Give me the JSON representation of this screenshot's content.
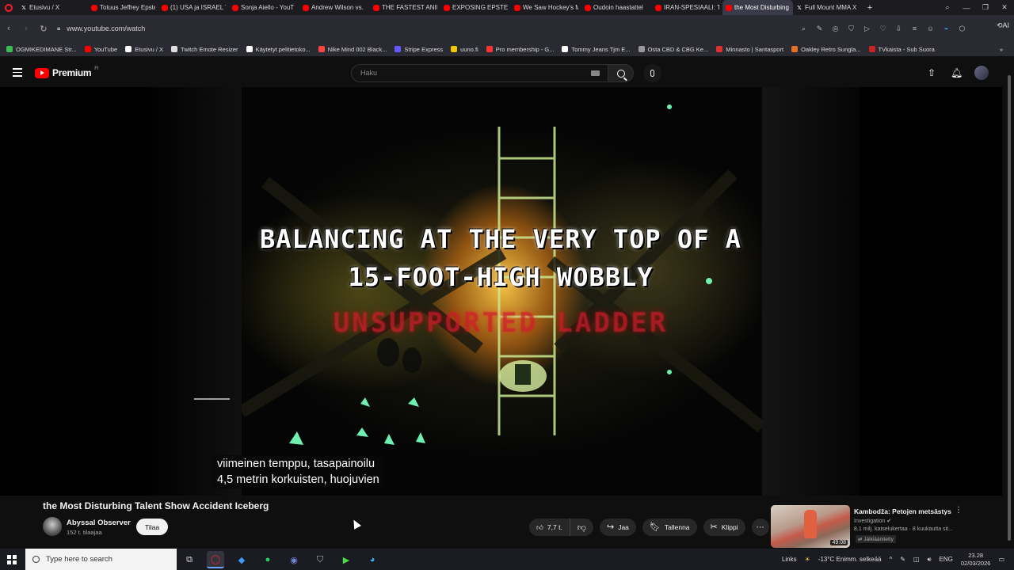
{
  "browser": {
    "tabs": [
      {
        "title": "Etusivu / X",
        "icon": "x-icon"
      },
      {
        "title": "Totuus Jeffrey Epste",
        "icon": "youtube-icon"
      },
      {
        "title": "(1) USA ja ISRAEL T",
        "icon": "youtube-icon"
      },
      {
        "title": "Sonja Aiello - YouT",
        "icon": "youtube-icon"
      },
      {
        "title": "Andrew Wilson vs.",
        "icon": "youtube-icon"
      },
      {
        "title": "THE FASTEST ANIM",
        "icon": "youtube-icon"
      },
      {
        "title": "EXPOSING EPSTEIN",
        "icon": "youtube-icon"
      },
      {
        "title": "We Saw Hockey's M",
        "icon": "youtube-icon"
      },
      {
        "title": "Oudoin haastattel",
        "icon": "youtube-icon"
      },
      {
        "title": "IRAN-SPESIAALI: Tr",
        "icon": "youtube-icon"
      },
      {
        "title": "the Most Disturbing T",
        "icon": "youtube-icon",
        "active": true
      },
      {
        "title": "Full Mount MMA X",
        "icon": "x-icon"
      }
    ],
    "url": "www.youtube.com/watch",
    "aria_label": "AI",
    "bookmarks": [
      {
        "label": "OGMIKEDIMANE Str...",
        "color": "#3cba54"
      },
      {
        "label": "YouTube",
        "color": "#ff0000"
      },
      {
        "label": "Etusivu / X",
        "color": "#ffffff"
      },
      {
        "label": "Twitch Emote Resizer",
        "color": "#dddddd"
      },
      {
        "label": "Käytetyt pelitietoko...",
        "color": "#ffffff"
      },
      {
        "label": "Nike Mind 002 Black...",
        "color": "#ff4444"
      },
      {
        "label": "Stripe Express",
        "color": "#635bff"
      },
      {
        "label": "uuno.fi",
        "color": "#f5c400"
      },
      {
        "label": "Pro membership - G...",
        "color": "#ff3333"
      },
      {
        "label": "Tommy Jeans Tjm E...",
        "color": "#ffffff"
      },
      {
        "label": "Osta CBD & CBG Ke...",
        "color": "#999999"
      },
      {
        "label": "Minnasto | Santasport",
        "color": "#e03030"
      },
      {
        "label": "Oakley Retro Sungla...",
        "color": "#e67020"
      },
      {
        "label": "TVkaista - Sub Suora",
        "color": "#cc2222"
      }
    ]
  },
  "youtube": {
    "brand": "Premium",
    "brand_suffix": "FI",
    "search_placeholder": "Haku"
  },
  "video": {
    "overlay_line1": "BALANCING AT THE VERY TOP OF A",
    "overlay_line2": "15-FOOT-HIGH WOBBLY",
    "overlay_red": "UNSUPPORTED LADDER",
    "subtitle_line1": "viimeinen temppu, tasapainoilu",
    "subtitle_line2": "4,5 metrin korkuisten, huojuvien",
    "title": "the Most Disturbing Talent Show Accident Iceberg",
    "channel": "Abyssal Observer",
    "subscribers": "152 t. tilaajaa",
    "subscribe_label": "Tilaa",
    "likes": "7,7 t.",
    "share_label": "Jaa",
    "save_label": "Tallenna",
    "clip_label": "Klippi"
  },
  "recommendation": {
    "title": "Kambodža: Petojen metsästys",
    "channel": "Investigation",
    "stats": "8,1 milj. katselukertaa · 8 kuukautta sit...",
    "badge": "Jälkiäänitetty",
    "duration": "49:08"
  },
  "taskbar": {
    "search_placeholder": "Type here to search",
    "links_label": "Links",
    "weather": "-13°C  Enimm. selkeää",
    "language": "ENG",
    "time": "23.28",
    "date": "02/03/2026"
  }
}
